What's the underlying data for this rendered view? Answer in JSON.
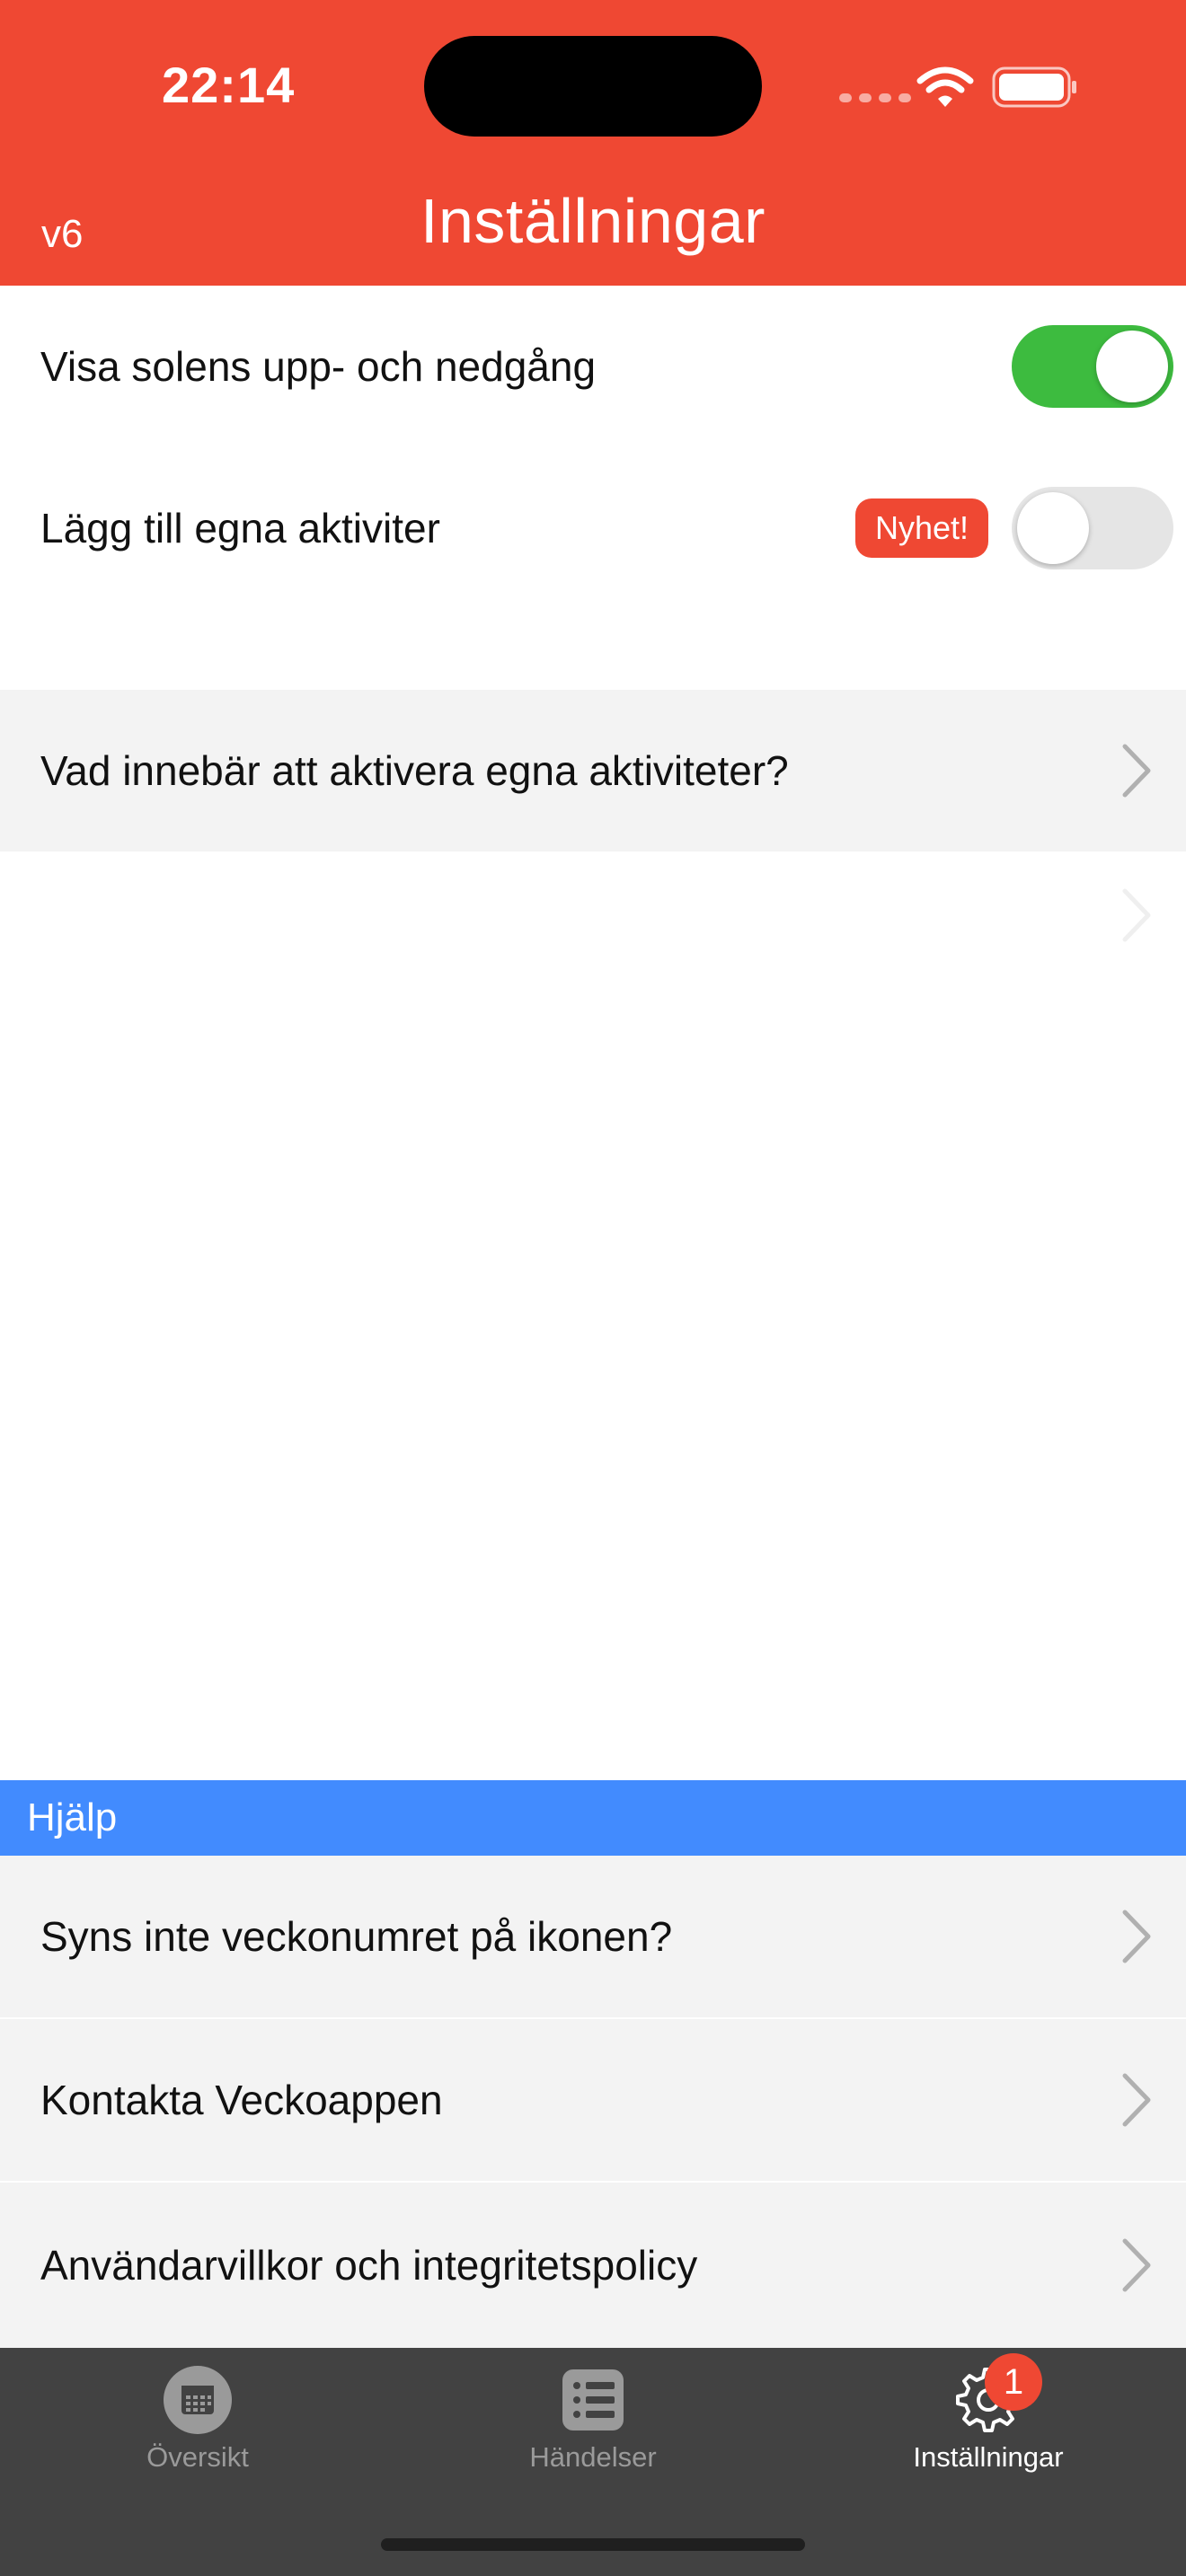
{
  "status_bar": {
    "time": "22:14"
  },
  "header": {
    "version": "v6",
    "title": "Inställningar",
    "background": "#ef4833"
  },
  "settings": {
    "sun_toggle": {
      "label": "Visa solens upp- och nedgång",
      "enabled": true
    },
    "custom_activities_toggle": {
      "label": "Lägg till egna aktiviter",
      "badge": "Nyhet!",
      "enabled": false
    },
    "info_link": {
      "label": "Vad innebär att aktivera egna aktiviteter?"
    }
  },
  "help": {
    "section_title": "Hjälp",
    "items": [
      {
        "label": "Syns inte veckonumret på ikonen?"
      },
      {
        "label": "Kontakta Veckoappen"
      },
      {
        "label": "Användarvillkor och integritetspolicy"
      }
    ]
  },
  "tabbar": {
    "tabs": [
      {
        "label": "Översikt",
        "icon": "calendar-icon",
        "active": false
      },
      {
        "label": "Händelser",
        "icon": "list-icon",
        "active": false
      },
      {
        "label": "Inställningar",
        "icon": "gear-icon",
        "active": true,
        "badge": "1"
      }
    ]
  },
  "colors": {
    "accent": "#ef4833",
    "toggle_on": "#3dbb3f",
    "section_header": "#428bfe",
    "tabbar": "#424242"
  }
}
